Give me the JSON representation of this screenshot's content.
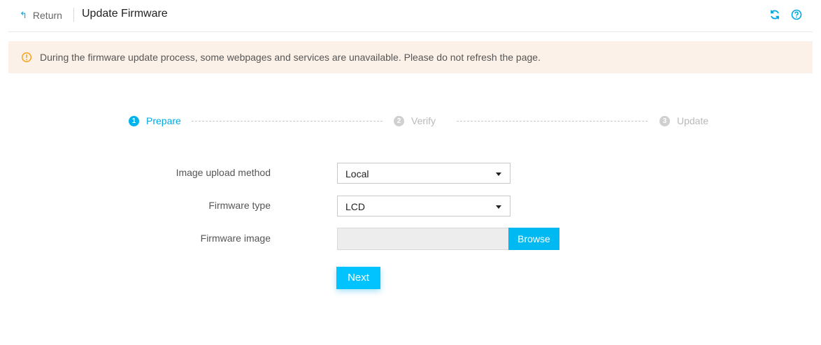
{
  "header": {
    "return_label": "Return",
    "title": "Update Firmware",
    "icons": [
      "refresh-icon",
      "help-icon"
    ],
    "accent_color": "#00a8e0"
  },
  "alert": {
    "icon": "warning-icon",
    "text": "During the firmware update process, some webpages and services are unavailable. Please do not refresh the page.",
    "background": "#fcf1e8",
    "icon_color": "#f5a623"
  },
  "steps": [
    {
      "number": "1",
      "label": "Prepare",
      "state": "active"
    },
    {
      "number": "2",
      "label": "Verify",
      "state": "inactive"
    },
    {
      "number": "3",
      "label": "Update",
      "state": "inactive"
    }
  ],
  "form": {
    "upload_method": {
      "label": "Image upload method",
      "value": "Local"
    },
    "firmware_type": {
      "label": "Firmware type",
      "value": "LCD"
    },
    "firmware_image": {
      "label": "Firmware image",
      "value": "",
      "browse_label": "Browse"
    },
    "next_label": "Next"
  }
}
